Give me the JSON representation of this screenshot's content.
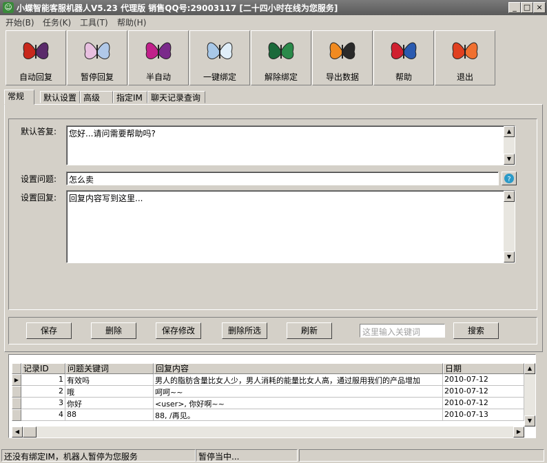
{
  "window": {
    "title": "小蝶智能客服机器人V5.23 代理版  销售QQ号:29003117 [二十四小时在线为您服务]",
    "min": "_",
    "max": "□",
    "close": "×"
  },
  "menu": [
    "开始(B)",
    "任务(K)",
    "工具(T)",
    "帮助(H)"
  ],
  "toolbar": [
    {
      "label": "自动回复",
      "icon": "butterfly-red-icon",
      "c1": "#c8281c",
      "c2": "#5a2a6a"
    },
    {
      "label": "暂停回复",
      "icon": "butterfly-pink-icon",
      "c1": "#e8c0e0",
      "c2": "#b0c8e8"
    },
    {
      "label": "半自动",
      "icon": "butterfly-magenta-icon",
      "c1": "#c0208a",
      "c2": "#7a2a8a"
    },
    {
      "label": "一键绑定",
      "icon": "butterfly-blue-icon",
      "c1": "#a8c8e8",
      "c2": "#e0eef8"
    },
    {
      "label": "解除绑定",
      "icon": "butterfly-green-icon",
      "c1": "#1a6a3a",
      "c2": "#2a8a4a"
    },
    {
      "label": "导出数据",
      "icon": "butterfly-orange-icon",
      "c1": "#f08a20",
      "c2": "#2a2a2a"
    },
    {
      "label": "帮助",
      "icon": "butterfly-redblue-icon",
      "c1": "#d02030",
      "c2": "#2a5ab0"
    },
    {
      "label": "退出",
      "icon": "butterfly-orange-red-icon",
      "c1": "#e04020",
      "c2": "#f07030"
    }
  ],
  "tabs": [
    "常规",
    "默认设置",
    "高级",
    "指定IM",
    "聊天记录查询"
  ],
  "form": {
    "default_reply_label": "默认答复:",
    "default_reply_value": "您好...请问需要帮助吗?",
    "question_label": "设置问题:",
    "question_value": "怎么卖",
    "reply_label": "设置回复:",
    "reply_value": "回复内容写到这里..."
  },
  "buttons": {
    "save": "保存",
    "delete": "删除",
    "save_edit": "保存修改",
    "delete_selected": "删除所选",
    "refresh": "刷新",
    "search": "搜索",
    "search_placeholder": "这里输入关键词"
  },
  "table": {
    "headers": [
      "记录ID",
      "问题关键词",
      "回复内容",
      "日期"
    ],
    "rows": [
      {
        "id": "1",
        "keyword": "有效吗",
        "reply": "男人的脂肪含量比女人少，男人消耗的能量比女人高，通过服用我们的产品增加",
        "date": "2010-07-12"
      },
      {
        "id": "2",
        "keyword": "哦",
        "reply": "呵呵~~",
        "date": "2010-07-12"
      },
      {
        "id": "3",
        "keyword": "你好",
        "reply": "<user>, 你好啊~~",
        "date": "2010-07-12"
      },
      {
        "id": "4",
        "keyword": "88",
        "reply": "88, /再见。",
        "date": "2010-07-13"
      }
    ]
  },
  "status": {
    "left": "还没有绑定IM，机器人暂停为您服务",
    "middle": "暂停当中..."
  }
}
